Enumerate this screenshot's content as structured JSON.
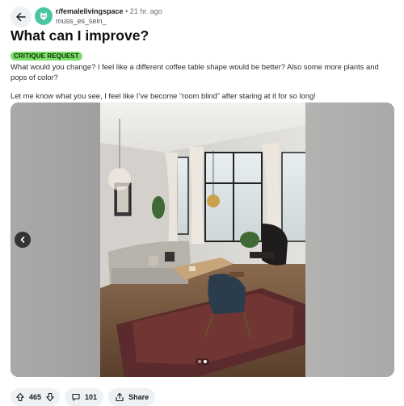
{
  "header": {
    "subreddit": "r/femalelivingspace",
    "separator": "•",
    "time_ago": "21 hr. ago",
    "username": "muss_es_sein_"
  },
  "post": {
    "title": "What can I improve?",
    "flair": "CRITIQUE REQUEST",
    "paragraphs": [
      "What would you change? I feel like a different coffee table shape would be better? Also some more plants and pops of color?",
      "Let me know what you see, I feel like I’ve become “room blind” after staring at it for so long!"
    ]
  },
  "carousel": {
    "total_images": 2,
    "current_index": 2
  },
  "actions": {
    "upvotes": "465",
    "comments": "101",
    "share_label": "Share"
  },
  "icons": {
    "back": "arrow-left-icon",
    "avatar": "subreddit-avatar-icon",
    "prev": "chevron-left-icon",
    "upvote": "upvote-arrow-icon",
    "downvote": "downvote-arrow-icon",
    "comment": "comment-bubble-icon",
    "share": "share-icon"
  },
  "colors": {
    "flair_bg": "#7ce06a",
    "avatar_bg": "#46c6a3",
    "pill_bg": "#eef1f3"
  }
}
